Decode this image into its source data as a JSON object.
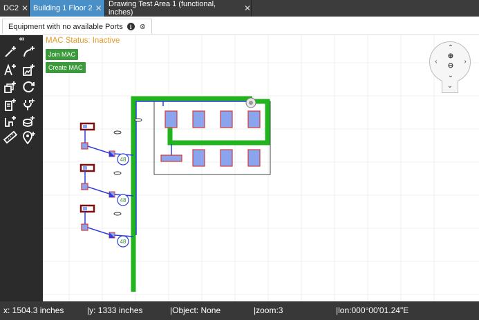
{
  "tabs": [
    {
      "label": "DC2",
      "close": "✕"
    },
    {
      "label": "Building 1 Floor 2",
      "close": "✕"
    },
    {
      "label": "Drawing Test Area 1 (functional, inches)",
      "close": "✕"
    }
  ],
  "subtab": {
    "label": "Equipment with no available Ports",
    "info": "i",
    "close": "⊗"
  },
  "toolbar": {
    "collapse": "‹‹‹"
  },
  "mac": {
    "status": "MAC Status: Inactive",
    "join_label": "Join MAC",
    "create_label": "Create MAC"
  },
  "drawing": {
    "port_labels": [
      "48",
      "48",
      "48"
    ]
  },
  "colors": {
    "green_conduit": "#22b41e",
    "device_fill": "#8aa5ee",
    "device_border": "#d23a3a",
    "link_blue": "#2b3de0",
    "mac_status": "#e39b2a",
    "button_green": "#3c9a3c"
  },
  "status": {
    "x": "x: 1504.3 inches",
    "y": "|y: 1333 inches",
    "object": "|Object: None",
    "zoom": "|zoom:3",
    "lon": "|lon:000°00'01.24\"E"
  }
}
